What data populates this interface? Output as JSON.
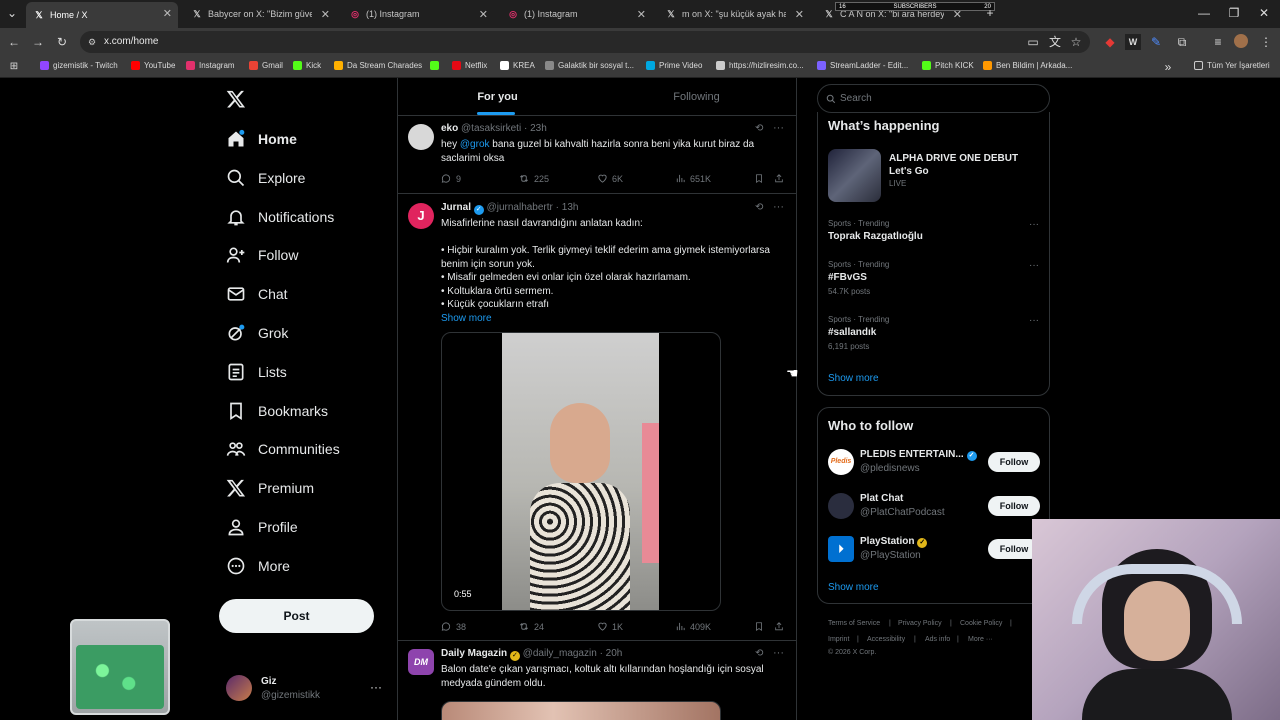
{
  "browser": {
    "tabs": [
      {
        "title": "Home / X",
        "icon": "x-logo-icon",
        "active": true
      },
      {
        "title": "Babycer on X: \"Bizim güven yeri",
        "icon": "x-logo-icon"
      },
      {
        "title": "(1) Instagram",
        "icon": "instagram-icon"
      },
      {
        "title": "(1) Instagram",
        "icon": "instagram-icon"
      },
      {
        "title": "m on X: \"şu küçük ayak hareket",
        "icon": "x-logo-icon"
      },
      {
        "title": "C A N on X: \"bi ara herdeyse tu",
        "icon": "x-logo-icon"
      }
    ],
    "overlay_subscribers": {
      "left": "16",
      "label": "SUBSCRIBERS",
      "right": "20"
    },
    "url": "x.com/home",
    "bookmarks": [
      {
        "label": "gizemistik - Twitch",
        "color": "#9146ff"
      },
      {
        "label": "YouTube",
        "color": "#ff0000"
      },
      {
        "label": "Instagram",
        "color": "#e1306c"
      },
      {
        "label": "Gmail",
        "color": "#ea4335"
      },
      {
        "label": "Kick",
        "color": "#53fc18"
      },
      {
        "label": "Da Stream Charades",
        "color": "#ffb000"
      },
      {
        "label": "",
        "color": "#53fc18"
      },
      {
        "label": "Netflix",
        "color": "#e50914"
      },
      {
        "label": "KREA",
        "color": "#ffffff"
      },
      {
        "label": "Galaktik bir sosyal t...",
        "color": "#888888"
      },
      {
        "label": "Prime Video",
        "color": "#00a8e1"
      },
      {
        "label": "https://hizliresim.co...",
        "color": "#cccccc"
      },
      {
        "label": "StreamLadder - Edit...",
        "color": "#7b61ff"
      },
      {
        "label": "Pitch KICK",
        "color": "#53fc18"
      },
      {
        "label": "Ben Bildim | Arkada...",
        "color": "#ff9800"
      }
    ],
    "all_bookmarks": "Tüm Yer İşaretleri"
  },
  "nav": {
    "items": [
      {
        "label": "Home",
        "icon": "home-icon"
      },
      {
        "label": "Explore",
        "icon": "search-icon"
      },
      {
        "label": "Notifications",
        "icon": "bell-icon"
      },
      {
        "label": "Follow",
        "icon": "add-person-icon"
      },
      {
        "label": "Chat",
        "icon": "mail-icon"
      },
      {
        "label": "Grok",
        "icon": "grok-icon"
      },
      {
        "label": "Lists",
        "icon": "list-icon"
      },
      {
        "label": "Bookmarks",
        "icon": "bookmark-icon"
      },
      {
        "label": "Communities",
        "icon": "people-icon"
      },
      {
        "label": "Premium",
        "icon": "x-logo-icon"
      },
      {
        "label": "Profile",
        "icon": "person-icon"
      },
      {
        "label": "More",
        "icon": "more-circle-icon"
      }
    ],
    "post": "Post",
    "account": {
      "name": "Giz",
      "handle": "@gizemistikk"
    }
  },
  "timeline": {
    "tabs": [
      {
        "label": "For you"
      },
      {
        "label": "Following"
      }
    ],
    "tweets": [
      {
        "name": "eko",
        "handle": "@tasaksirketi",
        "time": "23h",
        "text_pre": "hey ",
        "mention": "@grok",
        "text_post": " bana guzel bi kahvalti hazirla sonra beni yika kurut biraz da saclarimi oksa",
        "replies": "9",
        "reposts": "225",
        "likes": "6K",
        "views": "651K"
      },
      {
        "name": "Jurnal",
        "handle": "@jurnalhabertr",
        "time": "13h",
        "lines": [
          "Misafirlerine nasıl davrandığını anlatan kadın:",
          "",
          "• Hiçbir kuralım yok. Terlik giymeyi teklif ederim ama giymek istemiyorlarsa benim için sorun yok.",
          "• Misafir gelmeden evi onlar için özel olarak hazırlamam.",
          "• Koltuklara örtü sermem.",
          "• Küçük çocukların etrafı"
        ],
        "show_more": "Show more",
        "video_time": "0:55",
        "replies": "38",
        "reposts": "24",
        "likes": "1K",
        "views": "409K"
      },
      {
        "name": "Daily Magazin",
        "handle": "@daily_magazin",
        "time": "20h",
        "text": "Balon date'e çıkan yarışmacı, koltuk altı kıllarından hoşlandığı için sosyal medyada gündem oldu."
      }
    ]
  },
  "sidebar": {
    "search_placeholder": "Search",
    "happening": {
      "title": "What’s happening",
      "featured": {
        "title": "ALPHA DRIVE ONE DEBUT Let's Go",
        "status": "LIVE"
      },
      "trends": [
        {
          "meta": "Sports · Trending",
          "name": "Toprak Razgatlıoğlu",
          "posts": ""
        },
        {
          "meta": "Sports · Trending",
          "name": "#FBvGS",
          "posts": "54.7K posts"
        },
        {
          "meta": "Sports · Trending",
          "name": "#sallandık",
          "posts": "6,191 posts"
        }
      ],
      "show_more": "Show more"
    },
    "who_to_follow": {
      "title": "Who to follow",
      "accounts": [
        {
          "name": "PLEDIS ENTERTAIN...",
          "handle": "@pledisnews",
          "verified": "blue",
          "color": "#ffffff"
        },
        {
          "name": "Plat Chat",
          "handle": "@PlatChatPodcast",
          "verified": "",
          "color": "#2a2d3e"
        },
        {
          "name": "PlayStation",
          "handle": "@PlayStation",
          "verified": "gold",
          "color": "#0070d1"
        }
      ],
      "follow": "Follow",
      "show_more": "Show more"
    },
    "footer": [
      "Terms of Service",
      "|",
      "Privacy Policy",
      "|",
      "Cookie Policy",
      "|",
      "Imprint",
      "|",
      "Accessibility",
      "|",
      "Ads info",
      "|",
      "More ···",
      "© 2026 X Corp."
    ]
  },
  "colors": {
    "accent": "#1d9bf0",
    "verified": "#1d9bf0",
    "gold": "#e2b719",
    "jurnal": "#e0245e",
    "daily": "#8e44ad"
  }
}
